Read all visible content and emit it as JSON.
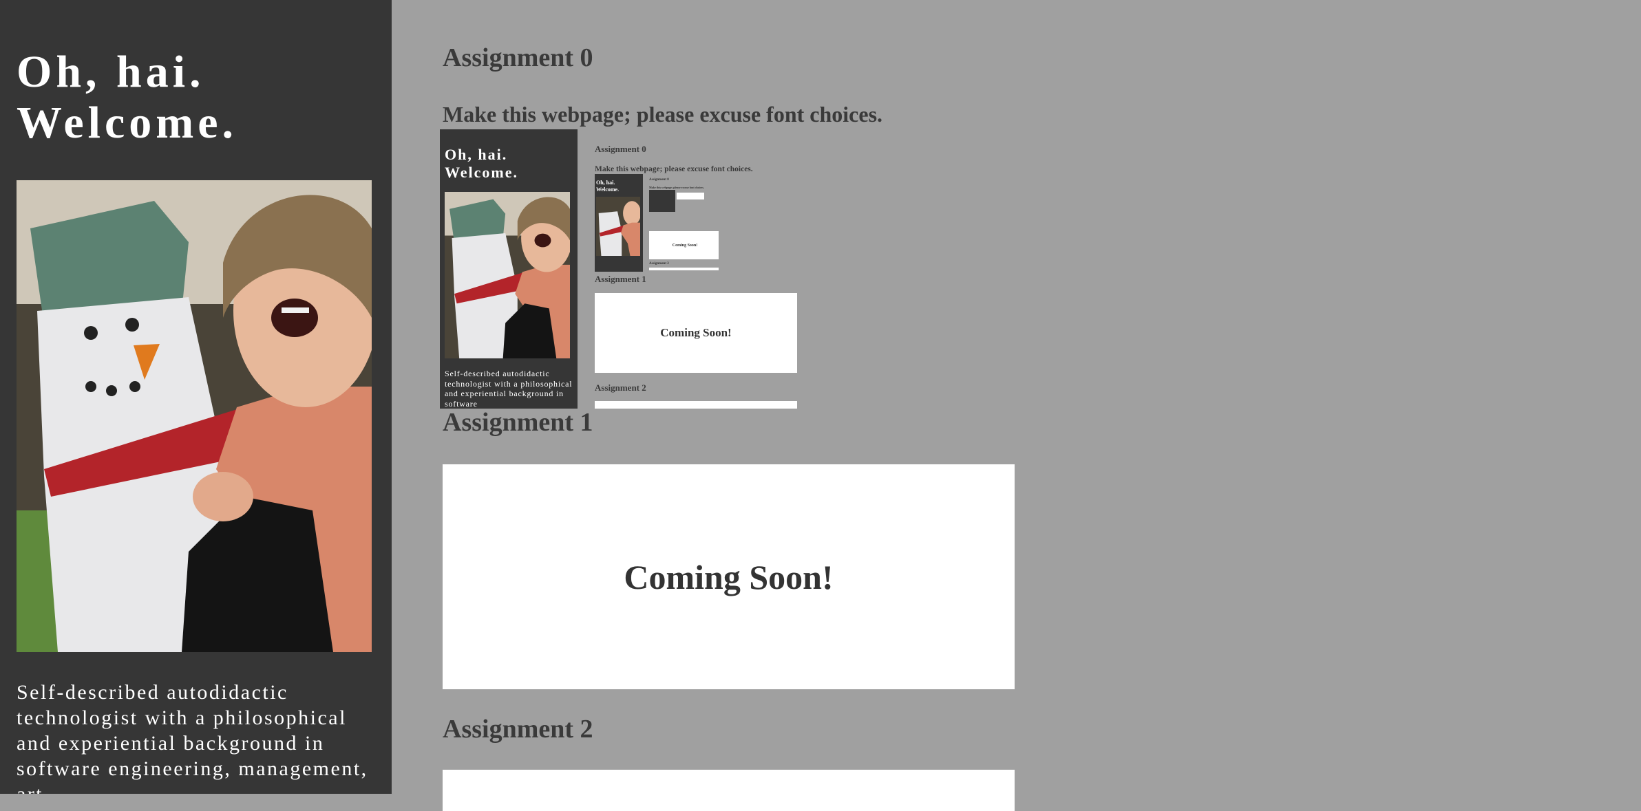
{
  "sidebar": {
    "title_line1": "Oh, hai.",
    "title_line2": "Welcome.",
    "bio": "Self-described autodidactic technologist with a philosophical and experiential background in software engineering, management, art"
  },
  "main": {
    "assignment0_heading": "Assignment 0",
    "instruction": "Make this webpage; please excuse font choices.",
    "assignment1_heading": "Assignment 1",
    "assignment1_card": "Coming Soon!",
    "assignment2_heading": "Assignment 2"
  },
  "embed": {
    "title_line1": "Oh, hai.",
    "title_line2": "Welcome.",
    "bio": "Self-described autodidactic technologist with a philosophical and experiential background in software",
    "assignment0_heading": "Assignment 0",
    "instruction": "Make this webpage; please excuse font choices.",
    "assignment1_heading": "Assignment 1",
    "assignment1_card": "Coming Soon!",
    "assignment2_heading": "Assignment 2"
  },
  "colors": {
    "background": "#a0a0a0",
    "sidebar": "#363636",
    "heading": "#3a3a3a",
    "card": "#ffffff"
  }
}
